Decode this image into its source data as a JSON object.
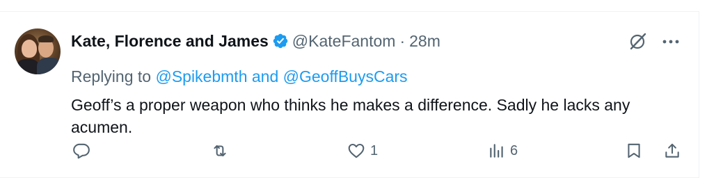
{
  "tweet": {
    "author_name": "Kate, Florence and James",
    "handle": "@KateFantom",
    "separator": "·",
    "time": "28m",
    "reply_prefix": "Replying to ",
    "reply_mention_1": "@Spikebmth",
    "reply_conj": " and ",
    "reply_mention_2": "@GeoffBuysCars",
    "text": "Geoff’s a proper weapon who thinks he makes a difference. Sadly he lacks any acumen."
  },
  "actions": {
    "replies": "",
    "reposts": "",
    "likes": "1",
    "views": "6"
  },
  "colors": {
    "text": "#0f1419",
    "secondary": "#536471",
    "accent": "#1d9bf0",
    "border": "#eff3f4"
  },
  "icons": [
    "verified-badge-icon",
    "grok-icon",
    "more-icon",
    "reply-icon",
    "repost-icon",
    "like-icon",
    "views-icon",
    "bookmark-icon",
    "share-icon"
  ]
}
